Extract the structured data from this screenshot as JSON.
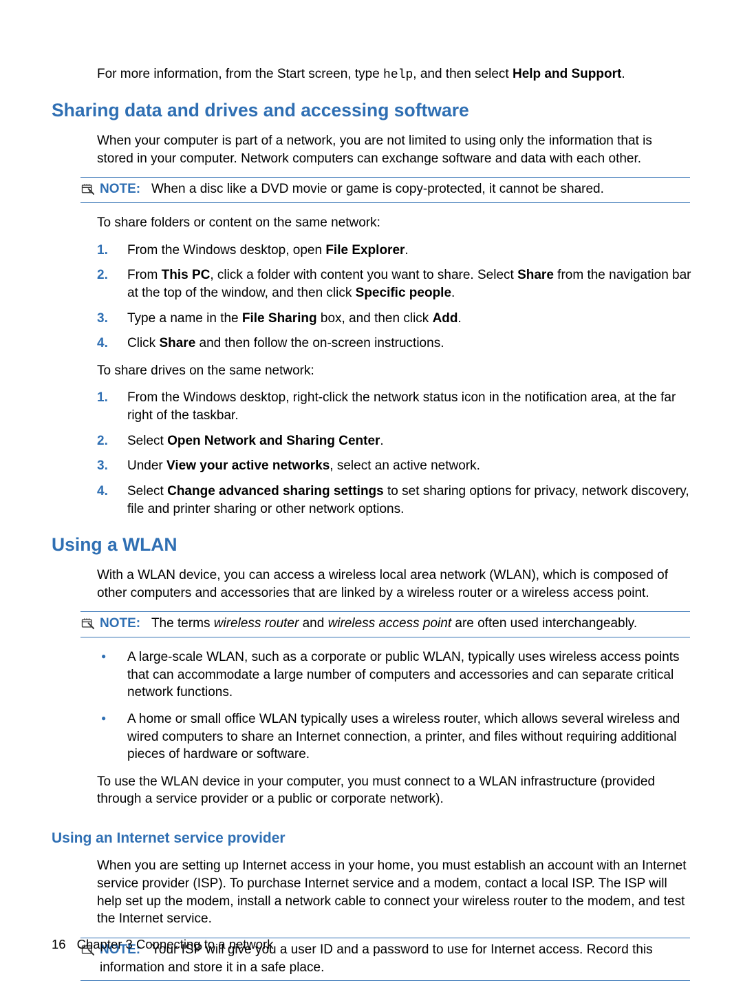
{
  "intro": {
    "pre": "For more information, from the Start screen, type ",
    "code": "help",
    "mid": ", and then select ",
    "bold": "Help and Support",
    "post": "."
  },
  "section1_title": "Sharing data and drives and accessing software",
  "s1_para": "When your computer is part of a network, you are not limited to using only the information that is stored in your computer. Network computers can exchange software and data with each other.",
  "note1": {
    "label": "NOTE:",
    "text": "When a disc like a DVD movie or game is copy-protected, it cannot be shared."
  },
  "s1_lead2": "To share folders or content on the same network:",
  "s1_steps": [
    {
      "num": "1.",
      "parts": [
        {
          "t": "From the Windows desktop, open "
        },
        {
          "b": "File Explorer"
        },
        {
          "t": "."
        }
      ]
    },
    {
      "num": "2.",
      "parts": [
        {
          "t": "From "
        },
        {
          "b": "This PC"
        },
        {
          "t": ", click a folder with content you want to share. Select "
        },
        {
          "b": "Share"
        },
        {
          "t": " from the navigation bar at the top of the window, and then click "
        },
        {
          "b": "Specific people"
        },
        {
          "t": "."
        }
      ]
    },
    {
      "num": "3.",
      "parts": [
        {
          "t": "Type a name in the "
        },
        {
          "b": "File Sharing"
        },
        {
          "t": " box, and then click "
        },
        {
          "b": "Add"
        },
        {
          "t": "."
        }
      ]
    },
    {
      "num": "4.",
      "parts": [
        {
          "t": "Click "
        },
        {
          "b": "Share"
        },
        {
          "t": " and then follow the on-screen instructions."
        }
      ]
    }
  ],
  "s1_lead3": "To share drives on the same network:",
  "s1_steps2": [
    {
      "num": "1.",
      "parts": [
        {
          "t": "From the Windows desktop, right-click the network status icon in the notification area, at the far right of the taskbar."
        }
      ]
    },
    {
      "num": "2.",
      "parts": [
        {
          "t": "Select "
        },
        {
          "b": "Open Network and Sharing Center"
        },
        {
          "t": "."
        }
      ]
    },
    {
      "num": "3.",
      "parts": [
        {
          "t": "Under "
        },
        {
          "b": "View your active networks"
        },
        {
          "t": ", select an active network."
        }
      ]
    },
    {
      "num": "4.",
      "parts": [
        {
          "t": "Select "
        },
        {
          "b": "Change advanced sharing settings"
        },
        {
          "t": " to set sharing options for privacy, network discovery, file and printer sharing or other network options."
        }
      ]
    }
  ],
  "section2_title": "Using a WLAN",
  "s2_para": "With a WLAN device, you can access a wireless local area network (WLAN), which is composed of other computers and accessories that are linked by a wireless router or a wireless access point.",
  "note2": {
    "label": "NOTE:",
    "pre": "The terms ",
    "i1": "wireless router",
    "mid": " and ",
    "i2": "wireless access point",
    "post": " are often used interchangeably."
  },
  "s2_bullets": [
    "A large-scale WLAN, such as a corporate or public WLAN, typically uses wireless access points that can accommodate a large number of computers and accessories and can separate critical network functions.",
    "A home or small office WLAN typically uses a wireless router, which allows several wireless and wired computers to share an Internet connection, a printer, and files without requiring additional pieces of hardware or software."
  ],
  "s2_para2": "To use the WLAN device in your computer, you must connect to a WLAN infrastructure (provided through a service provider or a public or corporate network).",
  "sub1_title": "Using an Internet service provider",
  "sub1_para": "When you are setting up Internet access in your home, you must establish an account with an Internet service provider (ISP). To purchase Internet service and a modem, contact a local ISP. The ISP will help set up the modem, install a network cable to connect your wireless router to the modem, and test the Internet service.",
  "note3": {
    "label": "NOTE:",
    "text": "Your ISP will give you a user ID and a password to use for Internet access. Record this information and store it in a safe place."
  },
  "footer": {
    "page": "16",
    "chapter": "Chapter 3   Connecting to a network"
  }
}
